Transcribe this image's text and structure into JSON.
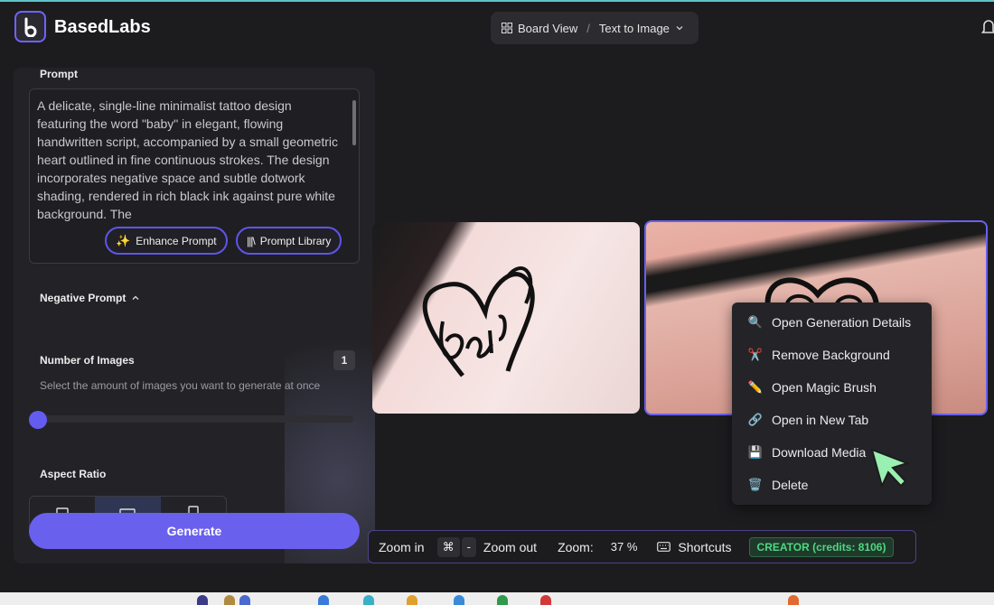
{
  "app": {
    "brand": "BasedLabs"
  },
  "breadcrumb": {
    "board_view": "Board View",
    "separator": "/",
    "current": "Text to Image"
  },
  "prompt": {
    "label": "Prompt",
    "text": "A delicate, single-line minimalist tattoo design featuring the word \"baby\" in elegant, flowing handwritten script, accompanied by a small geometric heart outlined in fine continuous strokes. The design incorporates negative space and subtle dotwork shading, rendered in rich black ink against pure white background. The",
    "enhance_label": "Enhance Prompt",
    "library_label": "Prompt Library"
  },
  "negative_prompt": {
    "label": "Negative Prompt"
  },
  "num_images": {
    "label": "Number of Images",
    "value": "1",
    "description": "Select the amount of images you want to generate at once",
    "slider_fraction": 0
  },
  "aspect_ratio": {
    "label": "Aspect Ratio",
    "selected_index": 1
  },
  "generate": {
    "label": "Generate"
  },
  "context_menu": {
    "items": [
      {
        "label": "Open Generation Details",
        "icon": "magnifier-icon"
      },
      {
        "label": "Remove Background",
        "icon": "scissors-icon"
      },
      {
        "label": "Open Magic Brush",
        "icon": "pencil-icon"
      },
      {
        "label": "Open in New Tab",
        "icon": "link-icon"
      },
      {
        "label": "Download Media",
        "icon": "floppy-icon"
      },
      {
        "label": "Delete",
        "icon": "trash-icon"
      }
    ]
  },
  "toolbar": {
    "zoom_in": "Zoom in",
    "cmd_key": "⌘",
    "minus_key": "-",
    "zoom_out": "Zoom out",
    "zoom_label": "Zoom:",
    "zoom_value": "37 %",
    "shortcuts": "Shortcuts",
    "plan": "CREATOR (credits: 8106)"
  },
  "colors": {
    "accent": "#6a60ee",
    "credits_green": "#4fd783",
    "cursor_green": "#9af0b0"
  }
}
